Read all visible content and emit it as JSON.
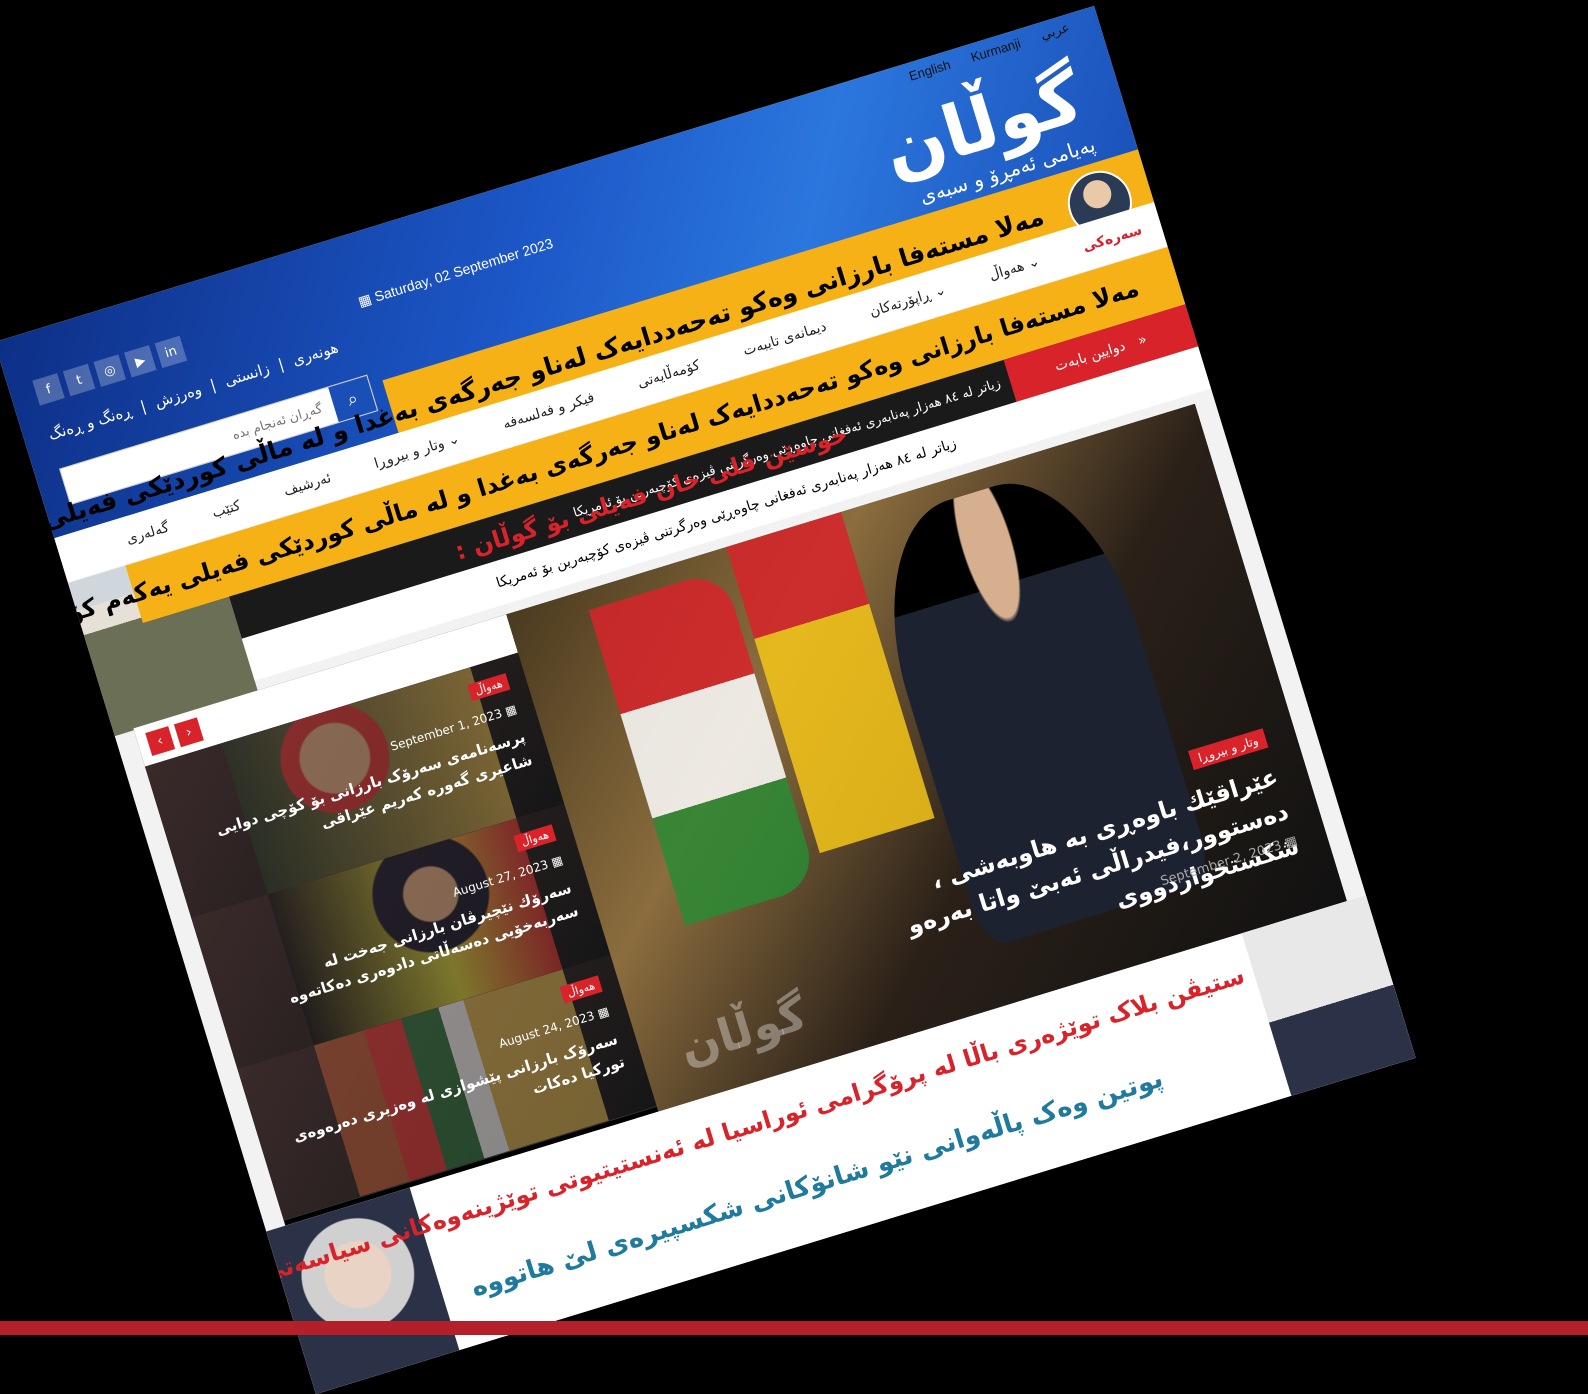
{
  "header": {
    "languages": [
      "عربي",
      "Kurmanji",
      "English"
    ],
    "logo": "گوڵان",
    "tagline": "پەیامی ئەمڕۆ و سبەی",
    "date": "Saturday, 02 September 2023",
    "social": [
      "f",
      "t",
      "◎",
      "▶",
      "in"
    ],
    "section_links": [
      "ڕەنگ و ڕەنگ",
      "وەرزش",
      "زانستی",
      "هونەری"
    ],
    "search_placeholder": "گەڕان ئەنجام بدە"
  },
  "banner_top": "مەلا مستەفا بارزانی وەکو تەحەددایەک لەناو جەرگەی بەغدا و لە ماڵی کوردێکی فەیلی یەکەم کۆنگرەی پارتی بەڕێوە برد",
  "nav": {
    "items": [
      "سەرەکی",
      "هەواڵ",
      "ڕاپۆرتەکان",
      "دیمانەی تایبەت",
      "کۆمەڵایەتی",
      "فیکر و فەلسەفە",
      "وتار و بیروڕا",
      "ئەرشیف",
      "کتێب",
      "گەلەری"
    ]
  },
  "ticker": {
    "label": "دوایین بابەت",
    "text": "زیاتر لە ٨٤ هەزار پەنابەری ئەفغانی چاوەڕێی وەرگرتنی ڤیزەی کۆچبەرین بۆ ئەمریکا"
  },
  "quote_title": "حوسێن قلی خان فەیلی بۆ گوڵان :",
  "featured": {
    "category": "وتار و بیروڕا",
    "title": "عێراقێك باوەڕی بە هاوبەشی ، دەستوور،فیدراڵی ئەبێ واتا بەرەو شکستخواردووی",
    "date": "September 2, 2023",
    "watermark": "گوڵان"
  },
  "side_items": [
    {
      "category": "هەواڵ",
      "date": "September 1, 2023",
      "title": "پرسەنامەی سەرۆک بارزانی بۆ کۆچی دوایی شاعیری گەورە کەریم عێراقی"
    },
    {
      "category": "هەواڵ",
      "date": "August 27, 2023",
      "title": "سەرۆك نێچیرڤان بارزانی جەخت لە سەربەخۆیی دەسەڵاتی دادوەری دەکاتەوە"
    },
    {
      "category": "هەواڵ",
      "date": "August 24, 2023",
      "title": "سەرۆک بارزانی پێشوازی لە وەزیری دەرەوەی تورکیا دەکات"
    }
  ],
  "banner_bottom": {
    "line1": "ستیڤن بلاک توێژەری باڵا لە پرۆگرامی ئوراسیا لە ئەنستیتیوتی توێژینەوەکانی سیاسەتی دەرەوە بۆ گوڵان :",
    "line2": "پوتین وەک پاڵەوانی نێو شانۆکانی شکسپیرەی لێ هاتووە"
  },
  "colors": {
    "accent": "#d8232a",
    "brand_blue": "#1c57c7",
    "banner_yellow": "#f5b115"
  }
}
